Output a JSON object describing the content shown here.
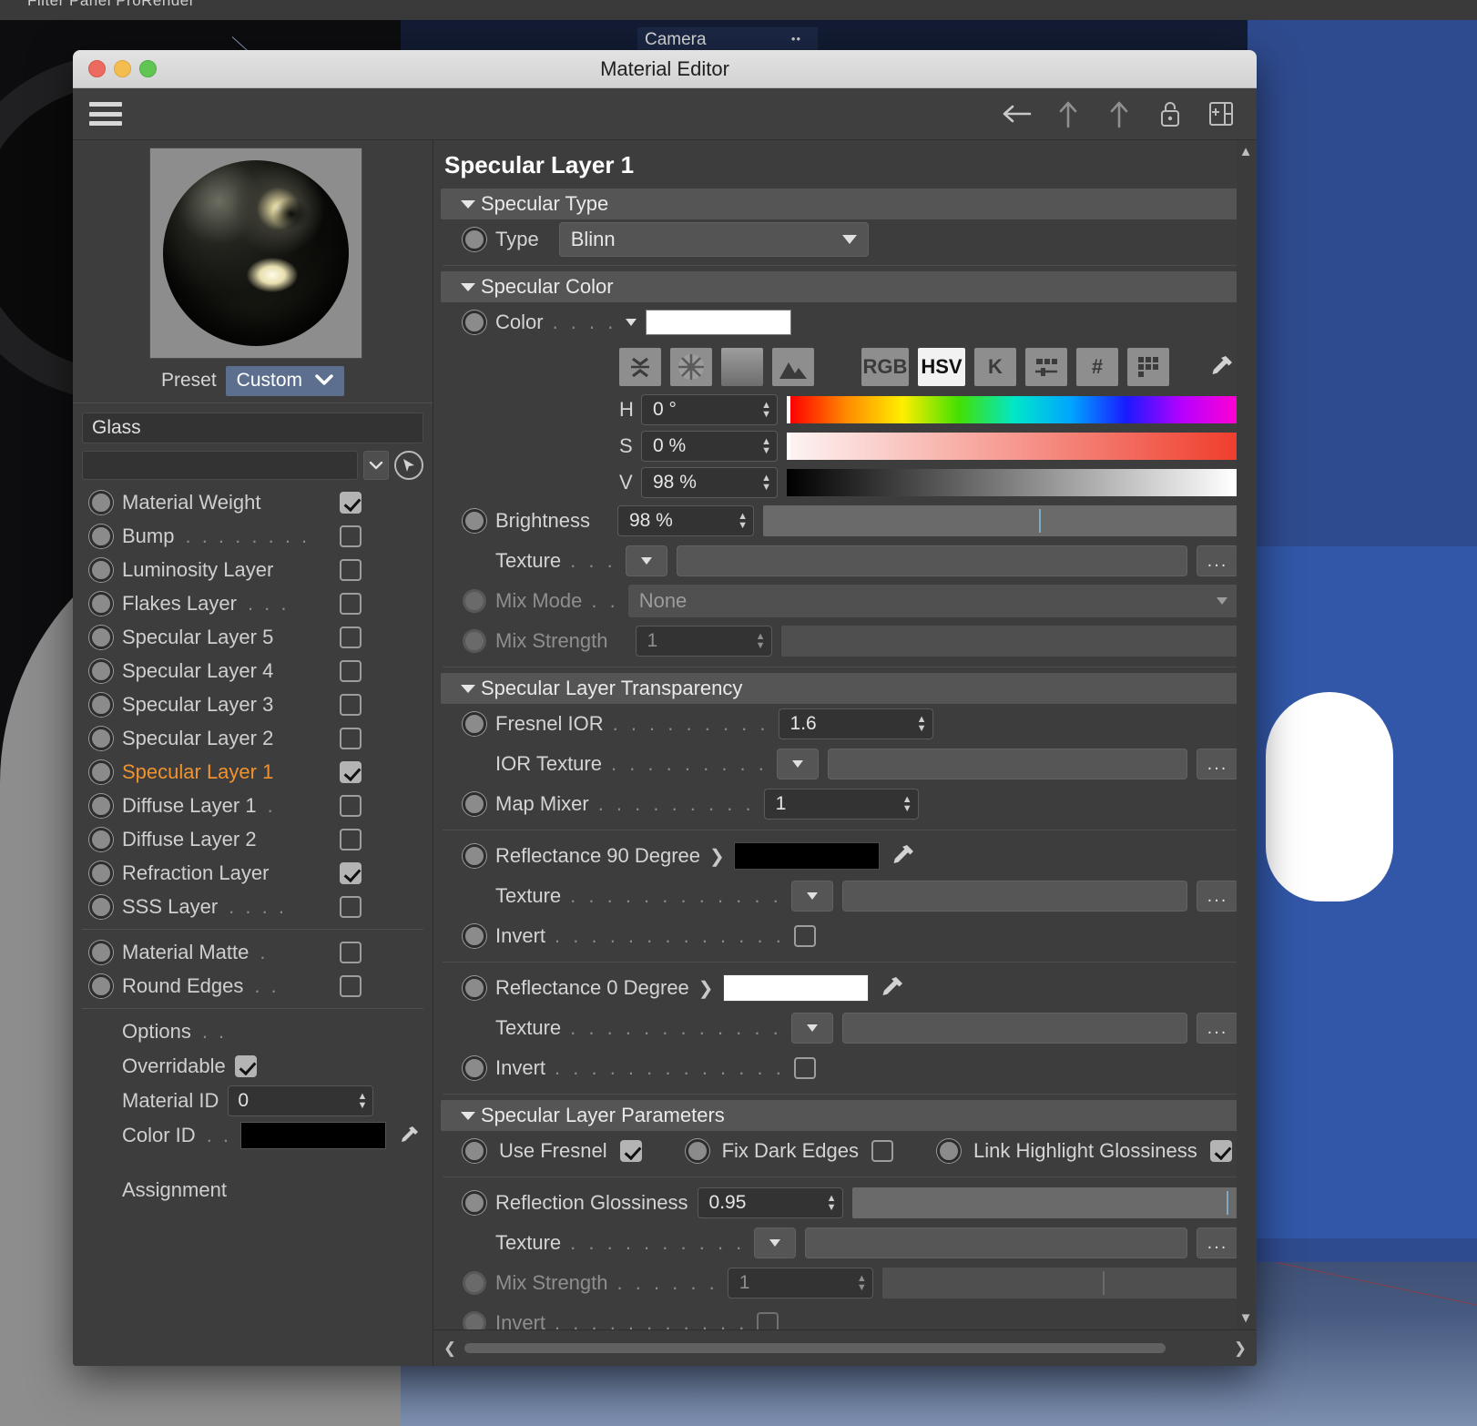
{
  "background": {
    "menu_items": "Filter   Panel   ProRender",
    "viewport_label": "Camera"
  },
  "window": {
    "title": "Material Editor",
    "traffic_lights": [
      "close-button",
      "minimize-button",
      "maximize-button"
    ],
    "toolbar": {
      "menu_icon": "hamburger-icon",
      "icons": [
        "back-arrow-icon",
        "up-arrow-icon",
        "up-arrow-alt-icon",
        "lock-icon",
        "add-panel-icon"
      ]
    }
  },
  "sidebar": {
    "preset_label": "Preset",
    "preset_value": "Custom",
    "material_name": "Glass",
    "search_value": "",
    "layers": [
      {
        "label": "Material Weight",
        "dots": "",
        "checked": true,
        "active": false
      },
      {
        "label": "Bump",
        "dots": ". . . . . . . .",
        "checked": false,
        "active": false
      },
      {
        "label": "Luminosity Layer",
        "dots": "",
        "checked": false,
        "active": false
      },
      {
        "label": "Flakes Layer",
        "dots": ". . .",
        "checked": false,
        "active": false
      },
      {
        "label": "Specular Layer 5",
        "dots": "",
        "checked": false,
        "active": false
      },
      {
        "label": "Specular Layer 4",
        "dots": "",
        "checked": false,
        "active": false
      },
      {
        "label": "Specular Layer 3",
        "dots": "",
        "checked": false,
        "active": false
      },
      {
        "label": "Specular Layer 2",
        "dots": "",
        "checked": false,
        "active": false
      },
      {
        "label": "Specular Layer 1",
        "dots": "",
        "checked": true,
        "active": true
      },
      {
        "label": "Diffuse Layer 1",
        "dots": ".",
        "checked": false,
        "active": false
      },
      {
        "label": "Diffuse Layer 2",
        "dots": "",
        "checked": false,
        "active": false
      },
      {
        "label": "Refraction Layer",
        "dots": "",
        "checked": true,
        "active": false
      },
      {
        "label": "SSS Layer",
        "dots": ". . . .",
        "checked": false,
        "active": false
      }
    ],
    "extra_layers": [
      {
        "label": "Material Matte",
        "dots": ".",
        "checked": false
      },
      {
        "label": "Round Edges",
        "dots": ". .",
        "checked": false
      }
    ],
    "options": {
      "title": "Options",
      "title_dots": ". .",
      "overridable_label": "Overridable",
      "overridable_checked": true,
      "material_id_label": "Material ID",
      "material_id_value": "0",
      "color_id_label": "Color ID",
      "color_id_dots": ". .",
      "color_id_value": "#000000"
    },
    "assignment_label": "Assignment"
  },
  "panel": {
    "title": "Specular Layer 1",
    "sections": {
      "specular_type": {
        "header": "Specular Type",
        "type_label": "Type",
        "type_value": "Blinn"
      },
      "specular_color": {
        "header": "Specular Color",
        "color_label": "Color",
        "color_dots": ". . . .",
        "color_value": "#ffffff",
        "mode_buttons": [
          "collapse-icon",
          "color-wheel-icon",
          "gradient-icon",
          "image-icon"
        ],
        "format_buttons": [
          {
            "label": "RGB",
            "active": false
          },
          {
            "label": "HSV",
            "active": true
          },
          {
            "label": "K",
            "active": false
          },
          {
            "label": "sliders-icon",
            "active": false
          },
          {
            "label": "#",
            "active": false
          },
          {
            "label": "swatches-icon",
            "active": false
          }
        ],
        "eyedropper": "eyedropper-icon",
        "hsv": [
          {
            "label": "H",
            "value": "0 °"
          },
          {
            "label": "S",
            "value": "0 %"
          },
          {
            "label": "V",
            "value": "98 %"
          }
        ],
        "brightness_label": "Brightness",
        "brightness_value": "98 %",
        "texture_label": "Texture",
        "texture_dots": ". . .",
        "texture_value": "",
        "texture_more": "...",
        "mix_mode_label": "Mix Mode",
        "mix_mode_dots": ". .",
        "mix_mode_value": "None",
        "mix_strength_label": "Mix Strength",
        "mix_strength_value": "1"
      },
      "transparency": {
        "header": "Specular Layer Transparency",
        "fresnel_ior_label": "Fresnel IOR",
        "fresnel_ior_dots": ". . . . . . . . .",
        "fresnel_ior_value": "1.6",
        "ior_texture_label": "IOR Texture",
        "ior_texture_dots": ". . . . . . . . .",
        "ior_texture_value": "",
        "ior_texture_more": "...",
        "map_mixer_label": "Map Mixer",
        "map_mixer_dots": ". . . . . . . . .",
        "map_mixer_value": "1",
        "reflectance90_label": "Reflectance 90 Degree",
        "reflectance90_color": "#000000",
        "reflectance90_texture_label": "Texture",
        "reflectance90_texture_dots": ". . . . . . . . . . . .",
        "reflectance90_more": "...",
        "invert90_label": "Invert",
        "invert90_dots": ". . . . . . . . . . . . .",
        "invert90_checked": false,
        "reflectance0_label": "Reflectance   0 Degree",
        "reflectance0_color": "#ffffff",
        "reflectance0_texture_label": "Texture",
        "reflectance0_texture_dots": ". . . . . . . . . . . .",
        "reflectance0_more": "...",
        "invert0_label": "Invert",
        "invert0_dots": ". . . . . . . . . . . . .",
        "invert0_checked": false
      },
      "parameters": {
        "header": "Specular Layer Parameters",
        "use_fresnel_label": "Use Fresnel",
        "use_fresnel_checked": true,
        "fix_dark_edges_label": "Fix Dark Edges",
        "fix_dark_edges_checked": false,
        "link_highlight_label": "Link Highlight Glossiness",
        "link_highlight_checked": true,
        "reflection_glossiness_label": "Reflection Glossiness",
        "reflection_glossiness_value": "0.95",
        "glossiness_texture_label": "Texture",
        "glossiness_texture_dots": ". . . . . . . . . .",
        "glossiness_texture_more": "...",
        "glossiness_mix_label": "Mix Strength",
        "glossiness_mix_dots": ". . . . . .",
        "glossiness_mix_value": "1",
        "glossiness_invert_label": "Invert",
        "glossiness_invert_dots": ". . . . . . . . . . .",
        "glossiness_invert_checked": false
      }
    }
  },
  "colors": {
    "accent_orange": "#f0932f",
    "preset_blue": "#5c6f8e",
    "panel_bg": "#3d3d3d",
    "section_header": "#555555"
  }
}
